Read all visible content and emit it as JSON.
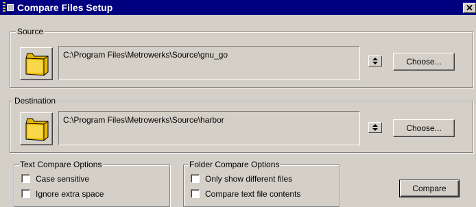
{
  "window": {
    "title": "Compare Files Setup",
    "close_label": "✕"
  },
  "source": {
    "group_label": "Source",
    "path": "C:\\Program Files\\Metrowerks\\Source\\gnu_go",
    "choose_label": "Choose..."
  },
  "destination": {
    "group_label": "Destination",
    "path": "C:\\Program Files\\Metrowerks\\Source\\harbor",
    "choose_label": "Choose..."
  },
  "text_options": {
    "group_label": "Text Compare Options",
    "items": [
      {
        "label": "Case sensitive",
        "checked": false
      },
      {
        "label": "Ignore extra space",
        "checked": false
      }
    ]
  },
  "folder_options": {
    "group_label": "Folder Compare Options",
    "items": [
      {
        "label": "Only show different files",
        "checked": false
      },
      {
        "label": "Compare text file contents",
        "checked": false
      }
    ]
  },
  "compare_button": {
    "label": "Compare"
  },
  "colors": {
    "title_bar": "#000080",
    "dialog_face": "#d4d0c8",
    "folder": "#e8b800"
  },
  "icons": {
    "folder": "folder-icon",
    "spin": "spin-updown-icon",
    "close": "close-icon"
  }
}
